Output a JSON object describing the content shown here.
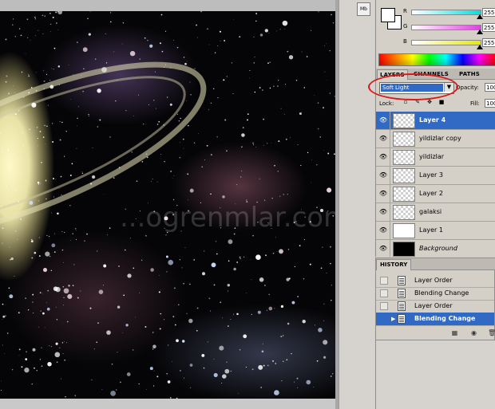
{
  "toolbar": {
    "mb_label": "Mb"
  },
  "color_panel": {
    "channels": [
      {
        "label": "R",
        "value": "255",
        "color": "#00d8d8"
      },
      {
        "label": "G",
        "value": "255",
        "color": "#e040e0"
      },
      {
        "label": "B",
        "value": "255",
        "color": "#e8e800"
      }
    ],
    "foreground": "#ffffff",
    "background": "#ffffff"
  },
  "layers_panel": {
    "tabs": [
      "LAYERS",
      "CHANNELS",
      "PATHS"
    ],
    "blend_mode": "Soft Light",
    "opacity_label": "Opacity:",
    "opacity_value": "100",
    "lock_label": "Lock:",
    "fill_label": "Fill:",
    "fill_value": "100",
    "layers": [
      {
        "name": "Layer 4",
        "selected": true,
        "thumb": "transparent"
      },
      {
        "name": "yildizlar copy",
        "selected": false,
        "thumb": "transparent"
      },
      {
        "name": "yildizlar",
        "selected": false,
        "thumb": "transparent"
      },
      {
        "name": "Layer 3",
        "selected": false,
        "thumb": "transparent"
      },
      {
        "name": "Layer 2",
        "selected": false,
        "thumb": "transparent"
      },
      {
        "name": "galaksi",
        "selected": false,
        "thumb": "transparent"
      },
      {
        "name": "Layer 1",
        "selected": false,
        "thumb": "white"
      },
      {
        "name": "Background",
        "selected": false,
        "thumb": "black",
        "italic": true
      }
    ]
  },
  "history_panel": {
    "tab_label": "HISTORY",
    "items": [
      {
        "label": "Layer Order",
        "selected": false
      },
      {
        "label": "Blending Change",
        "selected": false
      },
      {
        "label": "Layer Order",
        "selected": false
      },
      {
        "label": "Blending Change",
        "selected": true
      }
    ]
  },
  "watermark": "...ogrenmlar.com"
}
